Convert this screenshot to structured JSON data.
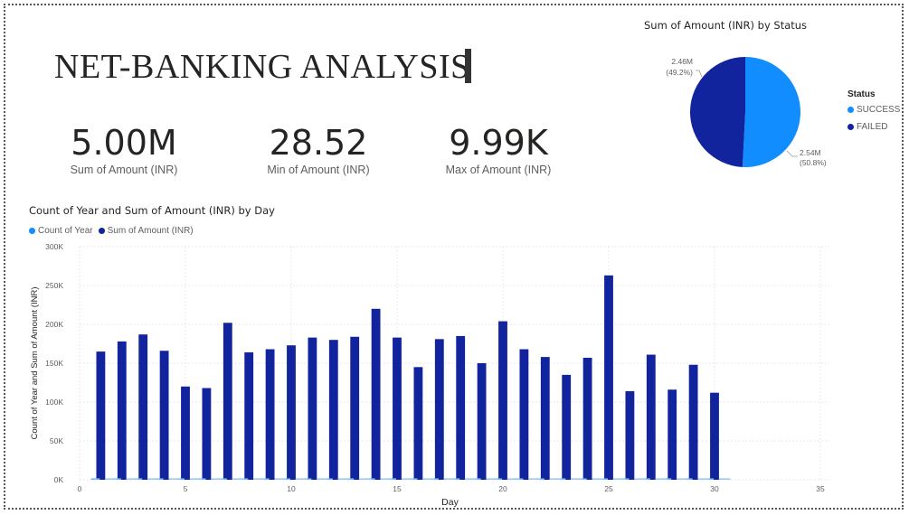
{
  "header": {
    "title": "NET-BANKING ANALYSIS"
  },
  "kpis": [
    {
      "value": "5.00M",
      "label": "Sum of Amount (INR)"
    },
    {
      "value": "28.52",
      "label": "Min of Amount (INR)"
    },
    {
      "value": "9.99K",
      "label": "Max of Amount (INR)"
    }
  ],
  "pie": {
    "title": "Sum of Amount (INR) by Status",
    "legend_title": "Status",
    "slices": [
      {
        "name": "SUCCESS",
        "value": 2540000,
        "label": "2.54M",
        "pct": "(50.8%)",
        "color": "#118DFF"
      },
      {
        "name": "FAILED",
        "value": 2460000,
        "label": "2.46M",
        "pct": "(49.2%)",
        "color": "#12239E"
      }
    ]
  },
  "chart_data": {
    "type": "bar",
    "title": "Count of Year and Sum of Amount (INR) by Day",
    "xlabel": "Day",
    "ylabel": "Count of Year and Sum of Amount (INR)",
    "xlim": [
      0,
      35
    ],
    "ylim": [
      0,
      300000
    ],
    "xticks": [
      0,
      5,
      10,
      15,
      20,
      25,
      30,
      35
    ],
    "yticks": [
      {
        "v": 0,
        "label": "0K"
      },
      {
        "v": 50000,
        "label": "50K"
      },
      {
        "v": 100000,
        "label": "100K"
      },
      {
        "v": 150000,
        "label": "150K"
      },
      {
        "v": 200000,
        "label": "200K"
      },
      {
        "v": 250000,
        "label": "250K"
      },
      {
        "v": 300000,
        "label": "300K"
      }
    ],
    "grid": true,
    "legend": "top-left",
    "x": [
      1,
      2,
      3,
      4,
      5,
      6,
      7,
      8,
      9,
      10,
      11,
      12,
      13,
      14,
      15,
      16,
      17,
      18,
      19,
      20,
      21,
      22,
      23,
      24,
      25,
      26,
      27,
      28,
      29,
      30
    ],
    "series": [
      {
        "name": "Count of Year",
        "color": "#118DFF",
        "values": [
          160,
          165,
          170,
          160,
          150,
          150,
          165,
          160,
          160,
          165,
          165,
          165,
          165,
          170,
          165,
          155,
          165,
          165,
          160,
          170,
          165,
          160,
          155,
          160,
          175,
          150,
          160,
          150,
          160,
          150
        ]
      },
      {
        "name": "Sum of Amount (INR)",
        "color": "#12239E",
        "values": [
          165000,
          178000,
          187000,
          166000,
          120000,
          118000,
          202000,
          164000,
          168000,
          173000,
          183000,
          180000,
          184000,
          220000,
          183000,
          145000,
          181000,
          185000,
          150000,
          204000,
          168000,
          158000,
          135000,
          157000,
          263000,
          114000,
          161000,
          116000,
          148000,
          112000
        ]
      }
    ]
  }
}
